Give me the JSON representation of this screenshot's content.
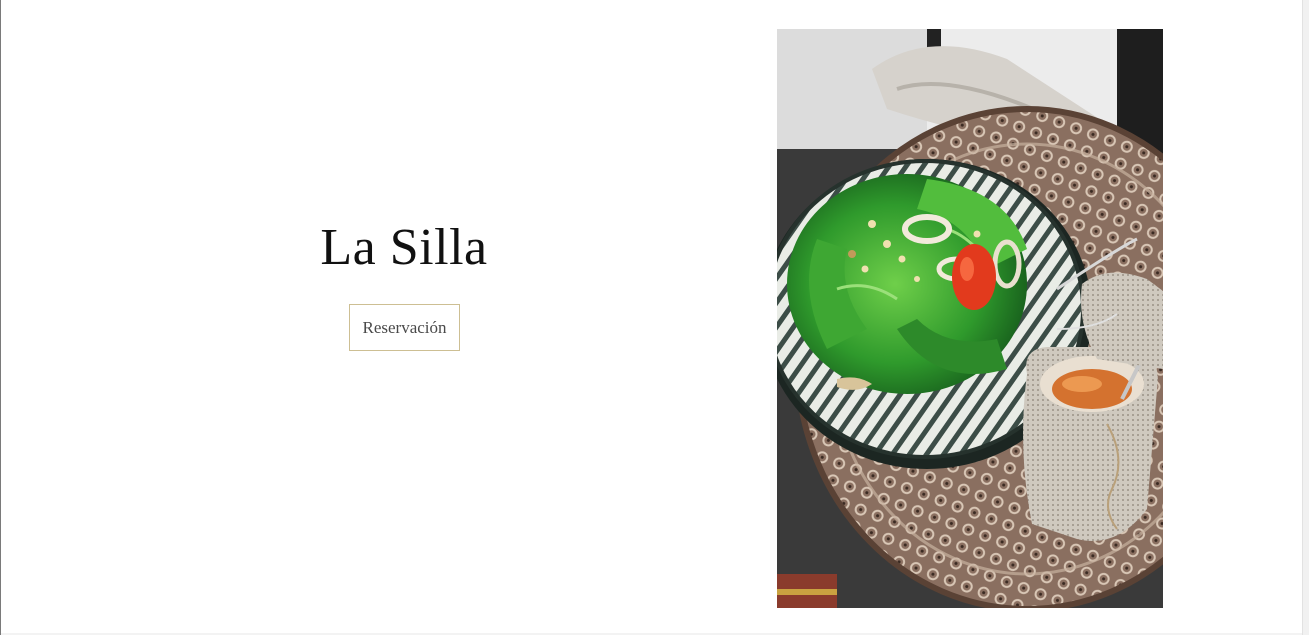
{
  "hero": {
    "title": "La Silla",
    "reserve_label": "Reservación"
  },
  "image": {
    "subject": "salad-bowl-photo",
    "alt": "Ensalada en plato sobre bandeja grabada"
  },
  "colors": {
    "background": "#ffffff",
    "title": "#111111",
    "button_border": "#cdbf93",
    "button_text": "#4a4a4a"
  }
}
